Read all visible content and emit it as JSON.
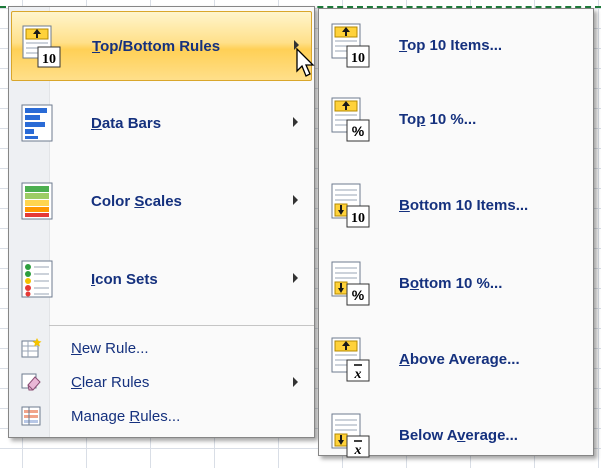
{
  "menu": {
    "top_bottom": {
      "pre": "",
      "key": "T",
      "post": "op/Bottom Rules"
    },
    "data_bars": {
      "pre": "",
      "key": "D",
      "post": "ata Bars"
    },
    "color_scales": {
      "pre": "Color ",
      "key": "S",
      "post": "cales"
    },
    "icon_sets": {
      "pre": "",
      "key": "I",
      "post": "con Sets"
    },
    "new_rule": {
      "pre": "",
      "key": "N",
      "post": "ew Rule..."
    },
    "clear_rules": {
      "pre": "",
      "key": "C",
      "post": "lear Rules"
    },
    "manage_rules": {
      "pre": "Manage ",
      "key": "R",
      "post": "ules..."
    }
  },
  "submenu": {
    "top10_items": {
      "pre": "",
      "key": "T",
      "post": "op 10 Items..."
    },
    "top10_pct": {
      "pre": "To",
      "key": "p",
      "post": " 10 %..."
    },
    "bottom10_items": {
      "pre": "",
      "key": "B",
      "post": "ottom 10 Items..."
    },
    "bottom10_pct": {
      "pre": "B",
      "key": "o",
      "post": "ttom 10 %..."
    },
    "above_avg": {
      "pre": "",
      "key": "A",
      "post": "bove Average..."
    },
    "below_avg": {
      "pre": "Below A",
      "key": "v",
      "post": "erage..."
    }
  },
  "icon_text": {
    "ten": "10",
    "pct": "%",
    "xbar": "x"
  },
  "colors": {
    "text": "#15317e",
    "hover_top": "#fff5cc",
    "hover_mid": "#ffd056",
    "hover_border": "#d9a62b"
  }
}
